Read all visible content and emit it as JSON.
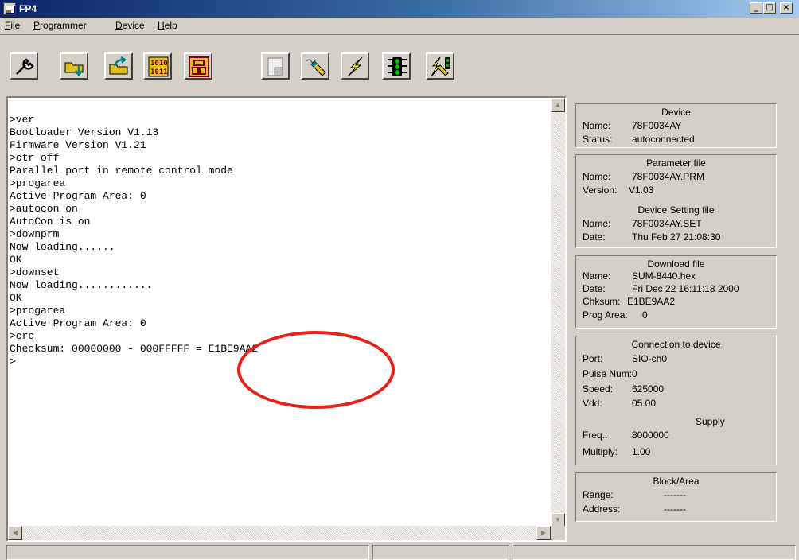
{
  "window": {
    "title": "FP4"
  },
  "menu": [
    "File",
    "Programmer",
    "Device",
    "Help"
  ],
  "toolbar": {
    "buttons": [
      {
        "name": "settings-wrench-icon"
      },
      {
        "name": "open-folder-down-icon"
      },
      {
        "name": "open-folder-up-icon"
      },
      {
        "name": "binary-data-icon"
      },
      {
        "name": "layout-block-icon"
      },
      {
        "name": "blank-page-icon"
      },
      {
        "name": "erase-pen-icon"
      },
      {
        "name": "lightning-program-icon"
      },
      {
        "name": "traffic-light-icon"
      },
      {
        "name": "autoprocedure-icon"
      }
    ]
  },
  "console": {
    "lines": [
      ">ver",
      "Bootloader Version V1.13",
      "Firmware Version V1.21",
      ">ctr off",
      "Parallel port in remote control mode",
      ">progarea",
      "Active Program Area: 0",
      ">autocon on",
      "AutoCon is on",
      ">downprm",
      "Now loading......",
      "OK",
      ">downset",
      "Now loading............",
      "OK",
      ">progarea",
      "Active Program Area: 0",
      ">crc",
      "Checksum: 00000000 - 000FFFFF = E1BE9AA2",
      ">"
    ]
  },
  "device_panel": {
    "title": "Device",
    "name_label": "Name:",
    "name_value": "78F0034AY",
    "status_label": "Status:",
    "status_value": "autoconnected"
  },
  "param_panel": {
    "title": "Parameter file",
    "name_label": "Name:",
    "name_value": "78F0034AY.PRM",
    "version_label": "Version:",
    "version_value": "V1.03",
    "setting_title": "Device Setting file",
    "set_name_label": "Name:",
    "set_name_value": "78F0034AY.SET",
    "date_label": "Date:",
    "date_value": "Thu Feb 27 21:08:30"
  },
  "download_panel": {
    "title": "Download file",
    "name_label": "Name:",
    "name_value": "SUM-8440.hex",
    "date_label": "Date:",
    "date_value": "Fri Dec 22 16:11:18 2000",
    "chksum_label": "Chksum:",
    "chksum_value": "E1BE9AA2",
    "progarea_label": "Prog Area:",
    "progarea_value": "0"
  },
  "connection_panel": {
    "title": "Connection to device",
    "port_label": "Port:",
    "port_value": "SIO-ch0",
    "pulse_label": "Pulse Num:",
    "pulse_value": "0",
    "speed_label": "Speed:",
    "speed_value": "625000",
    "vdd_label": "Vdd:",
    "vdd_value": "05.00",
    "supply_title": "Supply",
    "freq_label": "Freq.:",
    "freq_value": "8000000",
    "mult_label": "Multiply:",
    "mult_value": "1.00"
  },
  "block_panel": {
    "title": "Block/Area",
    "range_label": "Range:",
    "range_value": "-------",
    "address_label": "Address:",
    "address_value": "-------"
  },
  "colors": {
    "titlebar": "#0a246a",
    "highlight": "#e8201a",
    "face": "#d4d0c8"
  }
}
